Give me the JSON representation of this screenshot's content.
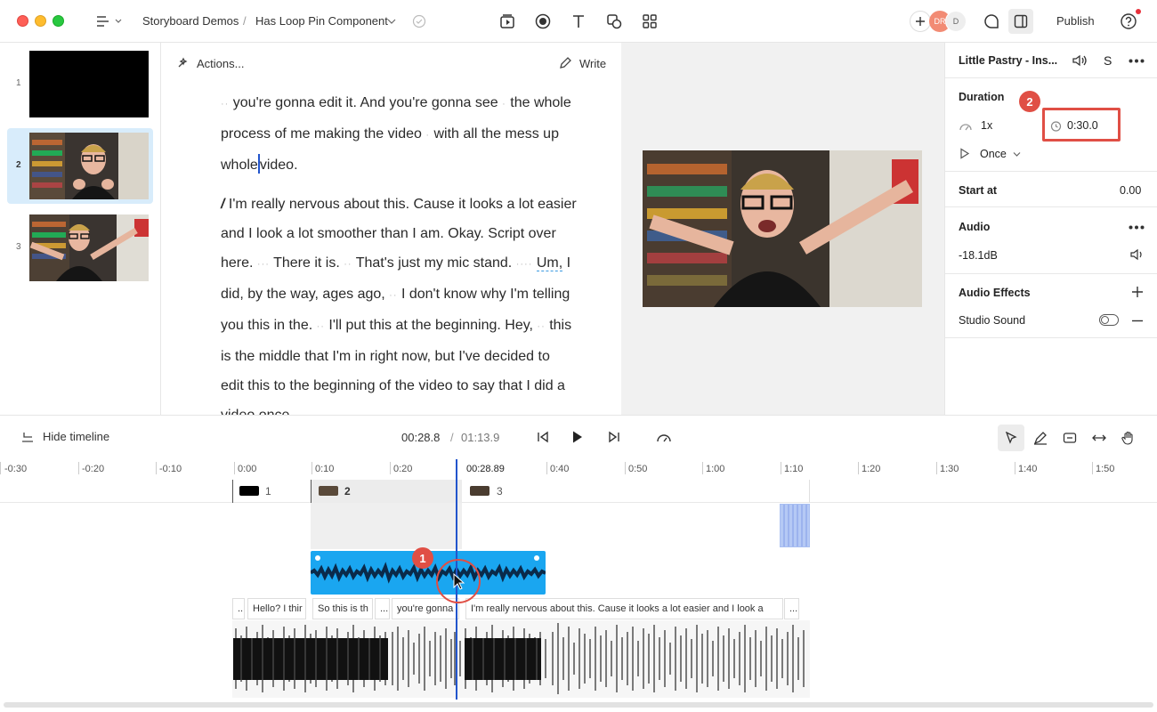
{
  "titlebar": {
    "breadcrumb_project": "Storyboard Demos",
    "breadcrumb_separator": "/",
    "breadcrumb_doc": "Has Loop Pin Component",
    "publish_label": "Publish",
    "avatar_1": "DR",
    "avatar_2": "D"
  },
  "scenes": [
    {
      "number": "1"
    },
    {
      "number": "2",
      "selected": true
    },
    {
      "number": "3"
    }
  ],
  "script": {
    "actions_label": "Actions...",
    "write_label": "Write",
    "para1": [
      {
        "pause": "··",
        "text": "you're gonna edit it. And you're gonna see"
      },
      {
        "pause": "·",
        "text": "the whole process of me making the video"
      },
      {
        "pause": "·",
        "text": "with all the mess up whole"
      },
      {
        "text": "video."
      }
    ],
    "para2_marker": "/",
    "para2": [
      {
        "text": "I'm really nervous about this. Cause it looks a lot easier and I look a lot smoother than I am. Okay. Script over here."
      },
      {
        "pause": "···",
        "text": "There it is."
      },
      {
        "pause": "··",
        "text": "That's just my mic stand."
      },
      {
        "pause": "····",
        "text": "Um,",
        "filler": true
      },
      {
        "text": "I did, by the way, ages ago,"
      },
      {
        "pause": "··",
        "text": "I don't know why I'm telling you this in the."
      },
      {
        "pause": "··",
        "text": "I'll put this at the beginning. Hey,"
      },
      {
        "pause": "··",
        "text": "this is the middle that I'm in right now, but I've decided to edit this to the beginning of the video to say that I did a video once"
      }
    ]
  },
  "rightpanel": {
    "title": "Little Pastry - Ins...",
    "s_label": "S",
    "duration_heading": "Duration",
    "speed": "1x",
    "duration_value": "0:30.0",
    "loop_mode": "Once",
    "start_at_label": "Start at",
    "start_at_value": "0.00",
    "audio_heading": "Audio",
    "audio_level": "-18.1dB",
    "effects_heading": "Audio Effects",
    "studio_sound": "Studio Sound"
  },
  "timeline": {
    "hide_label": "Hide timeline",
    "current_time": "00:28.8",
    "separator": "/",
    "total_time": "01:13.9",
    "playhead_label": "00:28.89",
    "ruler": [
      "-0:30",
      "-0:20",
      "-0:10",
      "0:00",
      "0:10",
      "0:20",
      "0:40",
      "0:50",
      "1:00",
      "1:10",
      "1:20",
      "1:30",
      "1:40",
      "1:50"
    ],
    "scene_labels": [
      "1",
      "2",
      "3"
    ],
    "words": [
      {
        "text": ".."
      },
      {
        "text": "Hello? I thir"
      },
      {
        "text": "So this is th"
      },
      {
        "text": "..."
      },
      {
        "text": "you're gonna"
      },
      {
        "text": "I'm really nervous about this. Cause it looks a lot easier and I look a"
      },
      {
        "text": "..."
      }
    ]
  },
  "annotations": {
    "callout_1": "1",
    "callout_2": "2"
  },
  "colors": {
    "accent_blue": "#1aa6f0",
    "selected_scene": "#d8ecfb",
    "callout_red": "#e04f45",
    "playhead": "#2255cc"
  }
}
